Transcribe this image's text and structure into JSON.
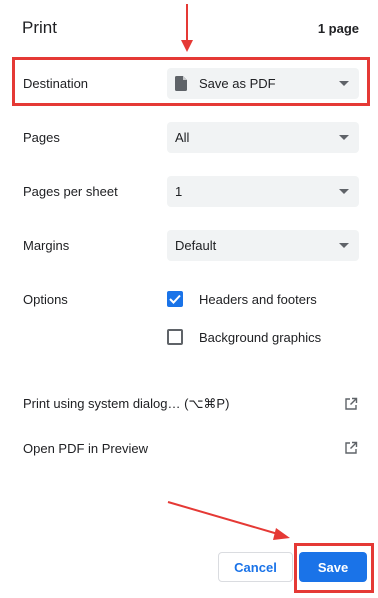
{
  "header": {
    "title": "Print",
    "page_count": "1 page"
  },
  "settings": {
    "destination": {
      "label": "Destination",
      "value": "Save as PDF",
      "icon": "document-icon"
    },
    "pages": {
      "label": "Pages",
      "value": "All"
    },
    "pages_per_sheet": {
      "label": "Pages per sheet",
      "value": "1"
    },
    "margins": {
      "label": "Margins",
      "value": "Default"
    },
    "options": {
      "label": "Options",
      "headers_footers": {
        "label": "Headers and footers",
        "checked": true
      },
      "background_graphics": {
        "label": "Background graphics",
        "checked": false
      }
    }
  },
  "links": {
    "system_dialog": {
      "label": "Print using system dialog… (⌥⌘P)",
      "icon": "open-external-icon"
    },
    "open_preview": {
      "label": "Open PDF in Preview",
      "icon": "open-external-icon"
    }
  },
  "buttons": {
    "cancel": "Cancel",
    "save": "Save"
  },
  "colors": {
    "accent": "#1a73e8",
    "annotation": "#e53935",
    "select_bg": "#f1f3f4"
  }
}
